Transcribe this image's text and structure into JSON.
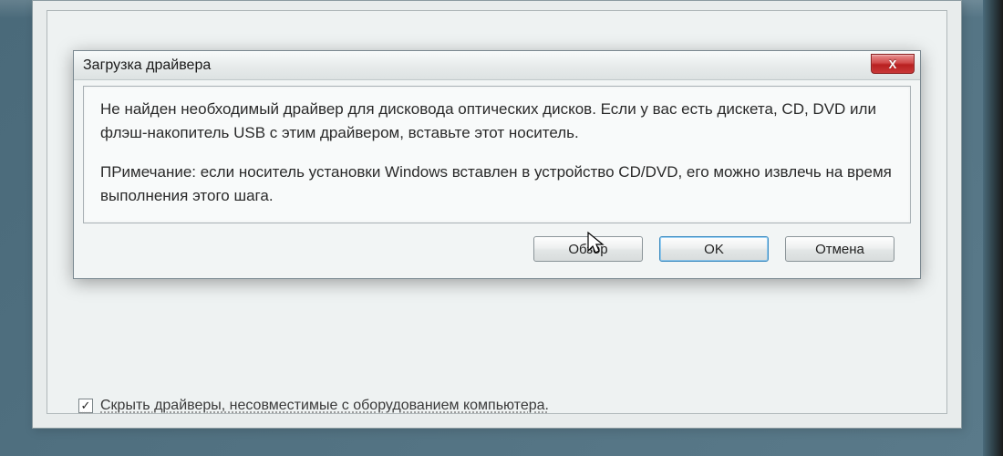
{
  "dialog": {
    "title": "Загрузка драйвера",
    "close_glyph": "X",
    "message_para1": "Не найден необходимый драйвер для дисковода оптических дисков. Если у вас есть дискета, CD, DVD или флэш-накопитель USB с этим драйвером, вставьте этот носитель.",
    "message_para2": "ПРимечание: если носитель установки Windows вставлен в устройство CD/DVD, его можно извлечь на время выполнения этого шага.",
    "buttons": {
      "browse": "Обзор",
      "ok": "OK",
      "cancel": "Отмена"
    }
  },
  "parent": {
    "hide_incompatible_label": "Скрыть драйверы, несовместимые с оборудованием компьютера.",
    "hide_incompatible_checked": "✓"
  }
}
